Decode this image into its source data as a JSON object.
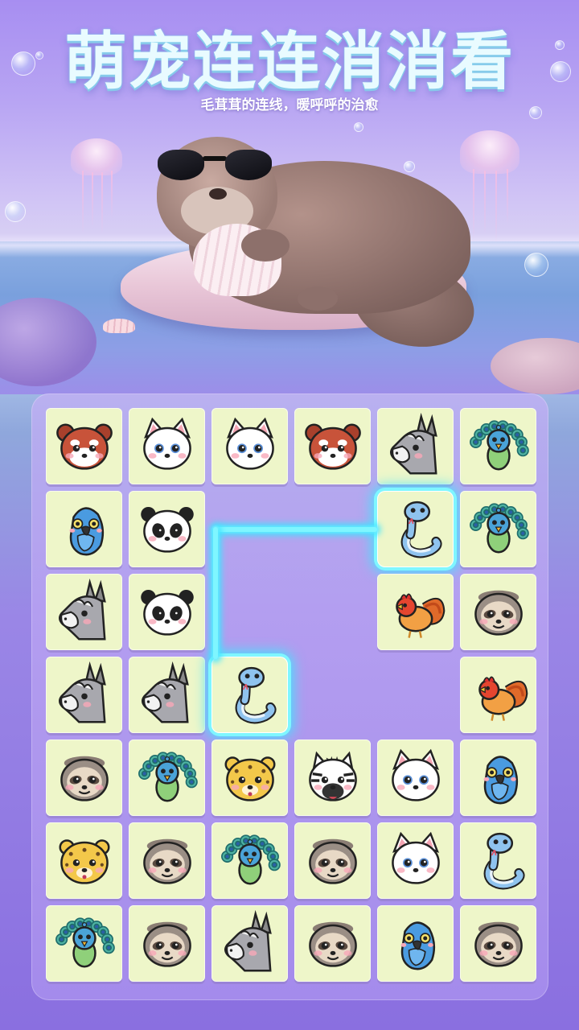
{
  "header": {
    "title": "萌宠连连消消看",
    "subtitle": "毛茸茸的连线，暖呼呼的治愈"
  },
  "board": {
    "rows": 7,
    "cols": 6,
    "cells": [
      [
        "red-panda",
        "white-cat",
        "white-cat",
        "red-panda",
        "donkey",
        "peacock"
      ],
      [
        "parrot",
        "panda",
        null,
        null,
        "snake",
        "peacock"
      ],
      [
        "donkey",
        "panda",
        null,
        null,
        "rooster",
        "sloth"
      ],
      [
        "donkey",
        "donkey",
        "snake",
        null,
        null,
        "rooster"
      ],
      [
        "sloth",
        "peacock",
        "leopard",
        "zebra",
        "white-cat",
        "parrot"
      ],
      [
        "leopard",
        "sloth",
        "peacock",
        "sloth",
        "white-cat",
        "snake"
      ],
      [
        "peacock",
        "sloth",
        "donkey",
        "sloth",
        "parrot",
        "sloth"
      ]
    ],
    "selected": [
      [
        1,
        4
      ],
      [
        3,
        2
      ]
    ]
  },
  "colors": {
    "tile_bg": "#eef6c9",
    "glow": "#3fe6ff",
    "title": "#e9fbff"
  }
}
